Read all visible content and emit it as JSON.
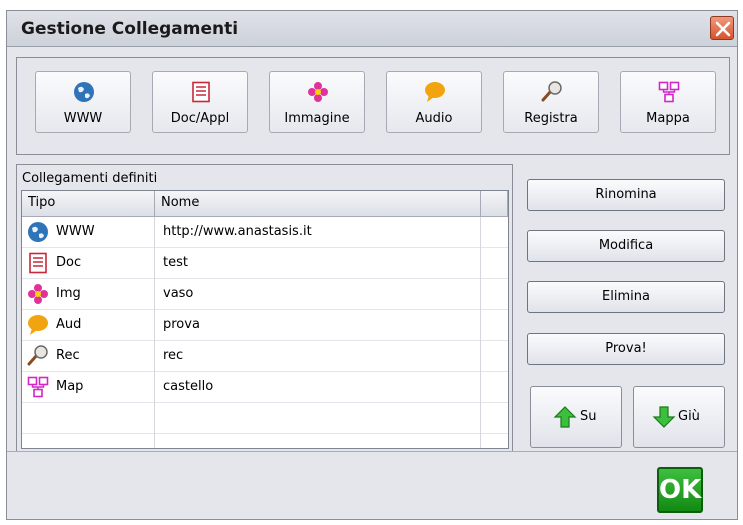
{
  "window": {
    "title": "Gestione Collegamenti"
  },
  "colors": {
    "accent_green": "#1f9e1f",
    "doc_red": "#c8283a",
    "img_pink": "#e0329a",
    "aud_orange": "#f2a410",
    "map_magenta": "#d226c8",
    "www_blue": "#2f74b8"
  },
  "toolbar": {
    "buttons": [
      {
        "label": "WWW",
        "icon": "globe-icon"
      },
      {
        "label": "Doc/Appl",
        "icon": "document-icon"
      },
      {
        "label": "Immagine",
        "icon": "flower-icon"
      },
      {
        "label": "Audio",
        "icon": "speech-bubble-icon"
      },
      {
        "label": "Registra",
        "icon": "microphone-icon"
      },
      {
        "label": "Mappa",
        "icon": "map-icon"
      }
    ]
  },
  "links": {
    "caption": "Collegamenti definiti",
    "columns": [
      "Tipo",
      "Nome",
      ""
    ],
    "rows": [
      {
        "tipo": "WWW",
        "nome": "http://www.anastasis.it",
        "icon": "globe-icon"
      },
      {
        "tipo": "Doc",
        "nome": "test",
        "icon": "document-icon"
      },
      {
        "tipo": "Img",
        "nome": "vaso",
        "icon": "flower-icon"
      },
      {
        "tipo": "Aud",
        "nome": "prova",
        "icon": "speech-bubble-icon"
      },
      {
        "tipo": "Rec",
        "nome": "rec",
        "icon": "microphone-icon"
      },
      {
        "tipo": "Map",
        "nome": "castello",
        "icon": "map-icon"
      }
    ]
  },
  "actions": {
    "rename": "Rinomina",
    "edit": "Modifica",
    "delete": "Elimina",
    "test": "Prova!",
    "up": "Su",
    "down": "Giù",
    "ok": "OK"
  }
}
